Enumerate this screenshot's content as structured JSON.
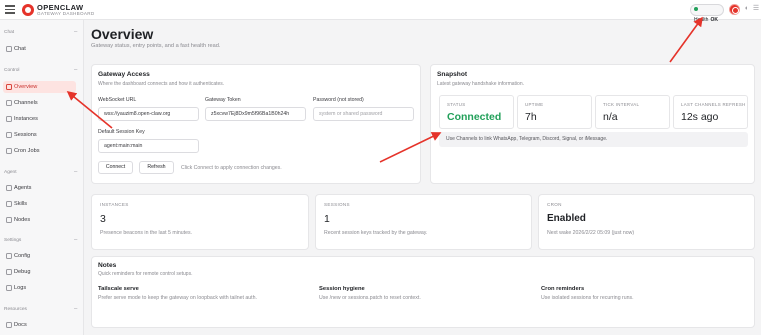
{
  "brand": {
    "name": "OPENCLAW",
    "subtitle": "GATEWAY DASHBOARD"
  },
  "topbar": {
    "health_label": "Health",
    "health_status": "OK"
  },
  "sidebar": {
    "sections": [
      {
        "label": "Chat",
        "items": [
          {
            "label": "Chat",
            "icon": "chat-icon"
          }
        ]
      },
      {
        "label": "Control",
        "items": [
          {
            "label": "Overview",
            "icon": "overview-icon",
            "active": true
          },
          {
            "label": "Channels",
            "icon": "link-icon"
          },
          {
            "label": "Instances",
            "icon": "radio-icon"
          },
          {
            "label": "Sessions",
            "icon": "document-icon"
          },
          {
            "label": "Cron Jobs",
            "icon": "clock-icon"
          }
        ]
      },
      {
        "label": "Agent",
        "items": [
          {
            "label": "Agents",
            "icon": "folder-icon"
          },
          {
            "label": "Skills",
            "icon": "bolt-icon"
          },
          {
            "label": "Nodes",
            "icon": "monitor-icon"
          }
        ]
      },
      {
        "label": "Settings",
        "items": [
          {
            "label": "Config",
            "icon": "gear-icon"
          },
          {
            "label": "Debug",
            "icon": "bug-icon"
          },
          {
            "label": "Logs",
            "icon": "file-icon"
          }
        ]
      },
      {
        "label": "Resources",
        "items": [
          {
            "label": "Docs",
            "icon": "book-icon"
          }
        ]
      }
    ]
  },
  "page": {
    "title": "Overview",
    "subtitle": "Gateway status, entry points, and a fast health read."
  },
  "gateway_access": {
    "title": "Gateway Access",
    "subtitle": "Where the dashboard connects and how it authenticates.",
    "websocket_label": "WebSocket URL",
    "websocket_value": "wss://yauzim8.open-claw.org",
    "token_label": "Gateway Token",
    "token_value": "z5xcvw7Ej8Dx9m5f96Ba1B0h24h",
    "password_label": "Password (not stored)",
    "password_placeholder": "system or shared password",
    "session_label": "Default Session Key",
    "session_value": "agent:main:main",
    "connect_label": "Connect",
    "refresh_label": "Refresh",
    "hint": "Click Connect to apply connection changes."
  },
  "snapshot": {
    "title": "Snapshot",
    "subtitle": "Latest gateway handshake information.",
    "stats": [
      {
        "label": "STATUS",
        "value": "Connected",
        "highlight": true
      },
      {
        "label": "UPTIME",
        "value": "7h"
      },
      {
        "label": "TICK INTERVAL",
        "value": "n/a"
      },
      {
        "label": "LAST CHANNELS REFRESH",
        "value": "12s ago"
      }
    ],
    "info": "Use Channels to link WhatsApp, Telegram, Discord, Signal, or iMessage."
  },
  "summary": [
    {
      "label": "INSTANCES",
      "value": "3",
      "desc": "Presence beacons in the last 5 minutes."
    },
    {
      "label": "SESSIONS",
      "value": "1",
      "desc": "Recent session keys tracked by the gateway."
    },
    {
      "label": "CRON",
      "value": "Enabled",
      "desc": "Next wake 2026/2/22 05:09 (just now)"
    }
  ],
  "notes": {
    "title": "Notes",
    "subtitle": "Quick reminders for remote control setups.",
    "items": [
      {
        "title": "Tailscale serve",
        "text": "Prefer serve mode to keep the gateway on loopback with tailnet auth."
      },
      {
        "title": "Session hygiene",
        "text": "Use /new or sessions.patch to reset context."
      },
      {
        "title": "Cron reminders",
        "text": "Use isolated sessions for recurring runs."
      }
    ]
  },
  "colors": {
    "accent": "#e5332a",
    "success": "#22a05a",
    "active_bg": "#fde3e1"
  }
}
